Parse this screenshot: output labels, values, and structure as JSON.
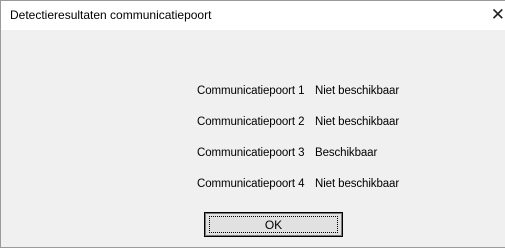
{
  "dialog": {
    "title": "Detectieresultaten communicatiepoort",
    "close_glyph": "✕"
  },
  "results": [
    {
      "port": "Communicatiepoort 1",
      "status": "Niet beschikbaar"
    },
    {
      "port": "Communicatiepoort 2",
      "status": "Niet beschikbaar"
    },
    {
      "port": "Communicatiepoort 3",
      "status": "Beschikbaar"
    },
    {
      "port": "Communicatiepoort 4",
      "status": "Niet beschikbaar"
    }
  ],
  "buttons": {
    "ok_label": "OK"
  }
}
